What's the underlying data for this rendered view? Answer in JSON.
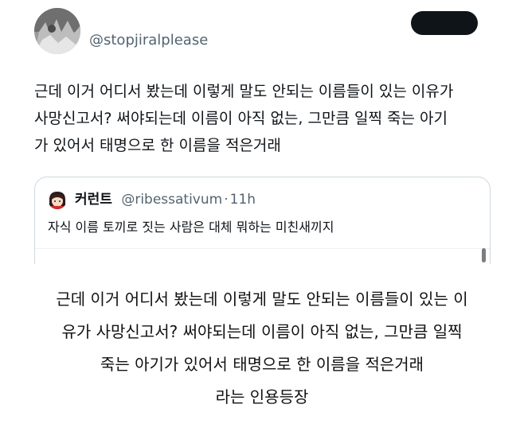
{
  "tweet": {
    "handle": "@stopjiralplease",
    "text": "근데 이거 어디서 봤는데 이렇게 말도 안되는 이름들이 있는 이유가\n사망신고서? 써야되는데 이름이 아직 없는, 그만큼 일찍 죽는 아기\n가 있어서 태명으로 한 이름을 적은거래"
  },
  "quote": {
    "name": "커런트",
    "handle": "@ribessativum",
    "separator": "·",
    "time": "11h",
    "text": "자식 이름 토끼로 짓는 사람은 대체 뭐하는 미친새끼지"
  },
  "caption": {
    "lines": [
      "근데 이거 어디서 봤는데 이렇게 말도 안되는 이름들이 있는 이",
      "유가 사망신고서? 써야되는데 이름이 아직 없는, 그만큼 일찍",
      "죽는 아기가 있어서 태명으로 한 이름을 적은거래",
      "라는 인용등장"
    ]
  },
  "colors": {
    "primary_text": "#0f1419",
    "secondary_text": "#536471",
    "card_border": "#cfd9de",
    "background": "#ffffff"
  },
  "icons": {
    "author_avatar": "avatar-image",
    "quote_avatar": "avatar-image"
  }
}
